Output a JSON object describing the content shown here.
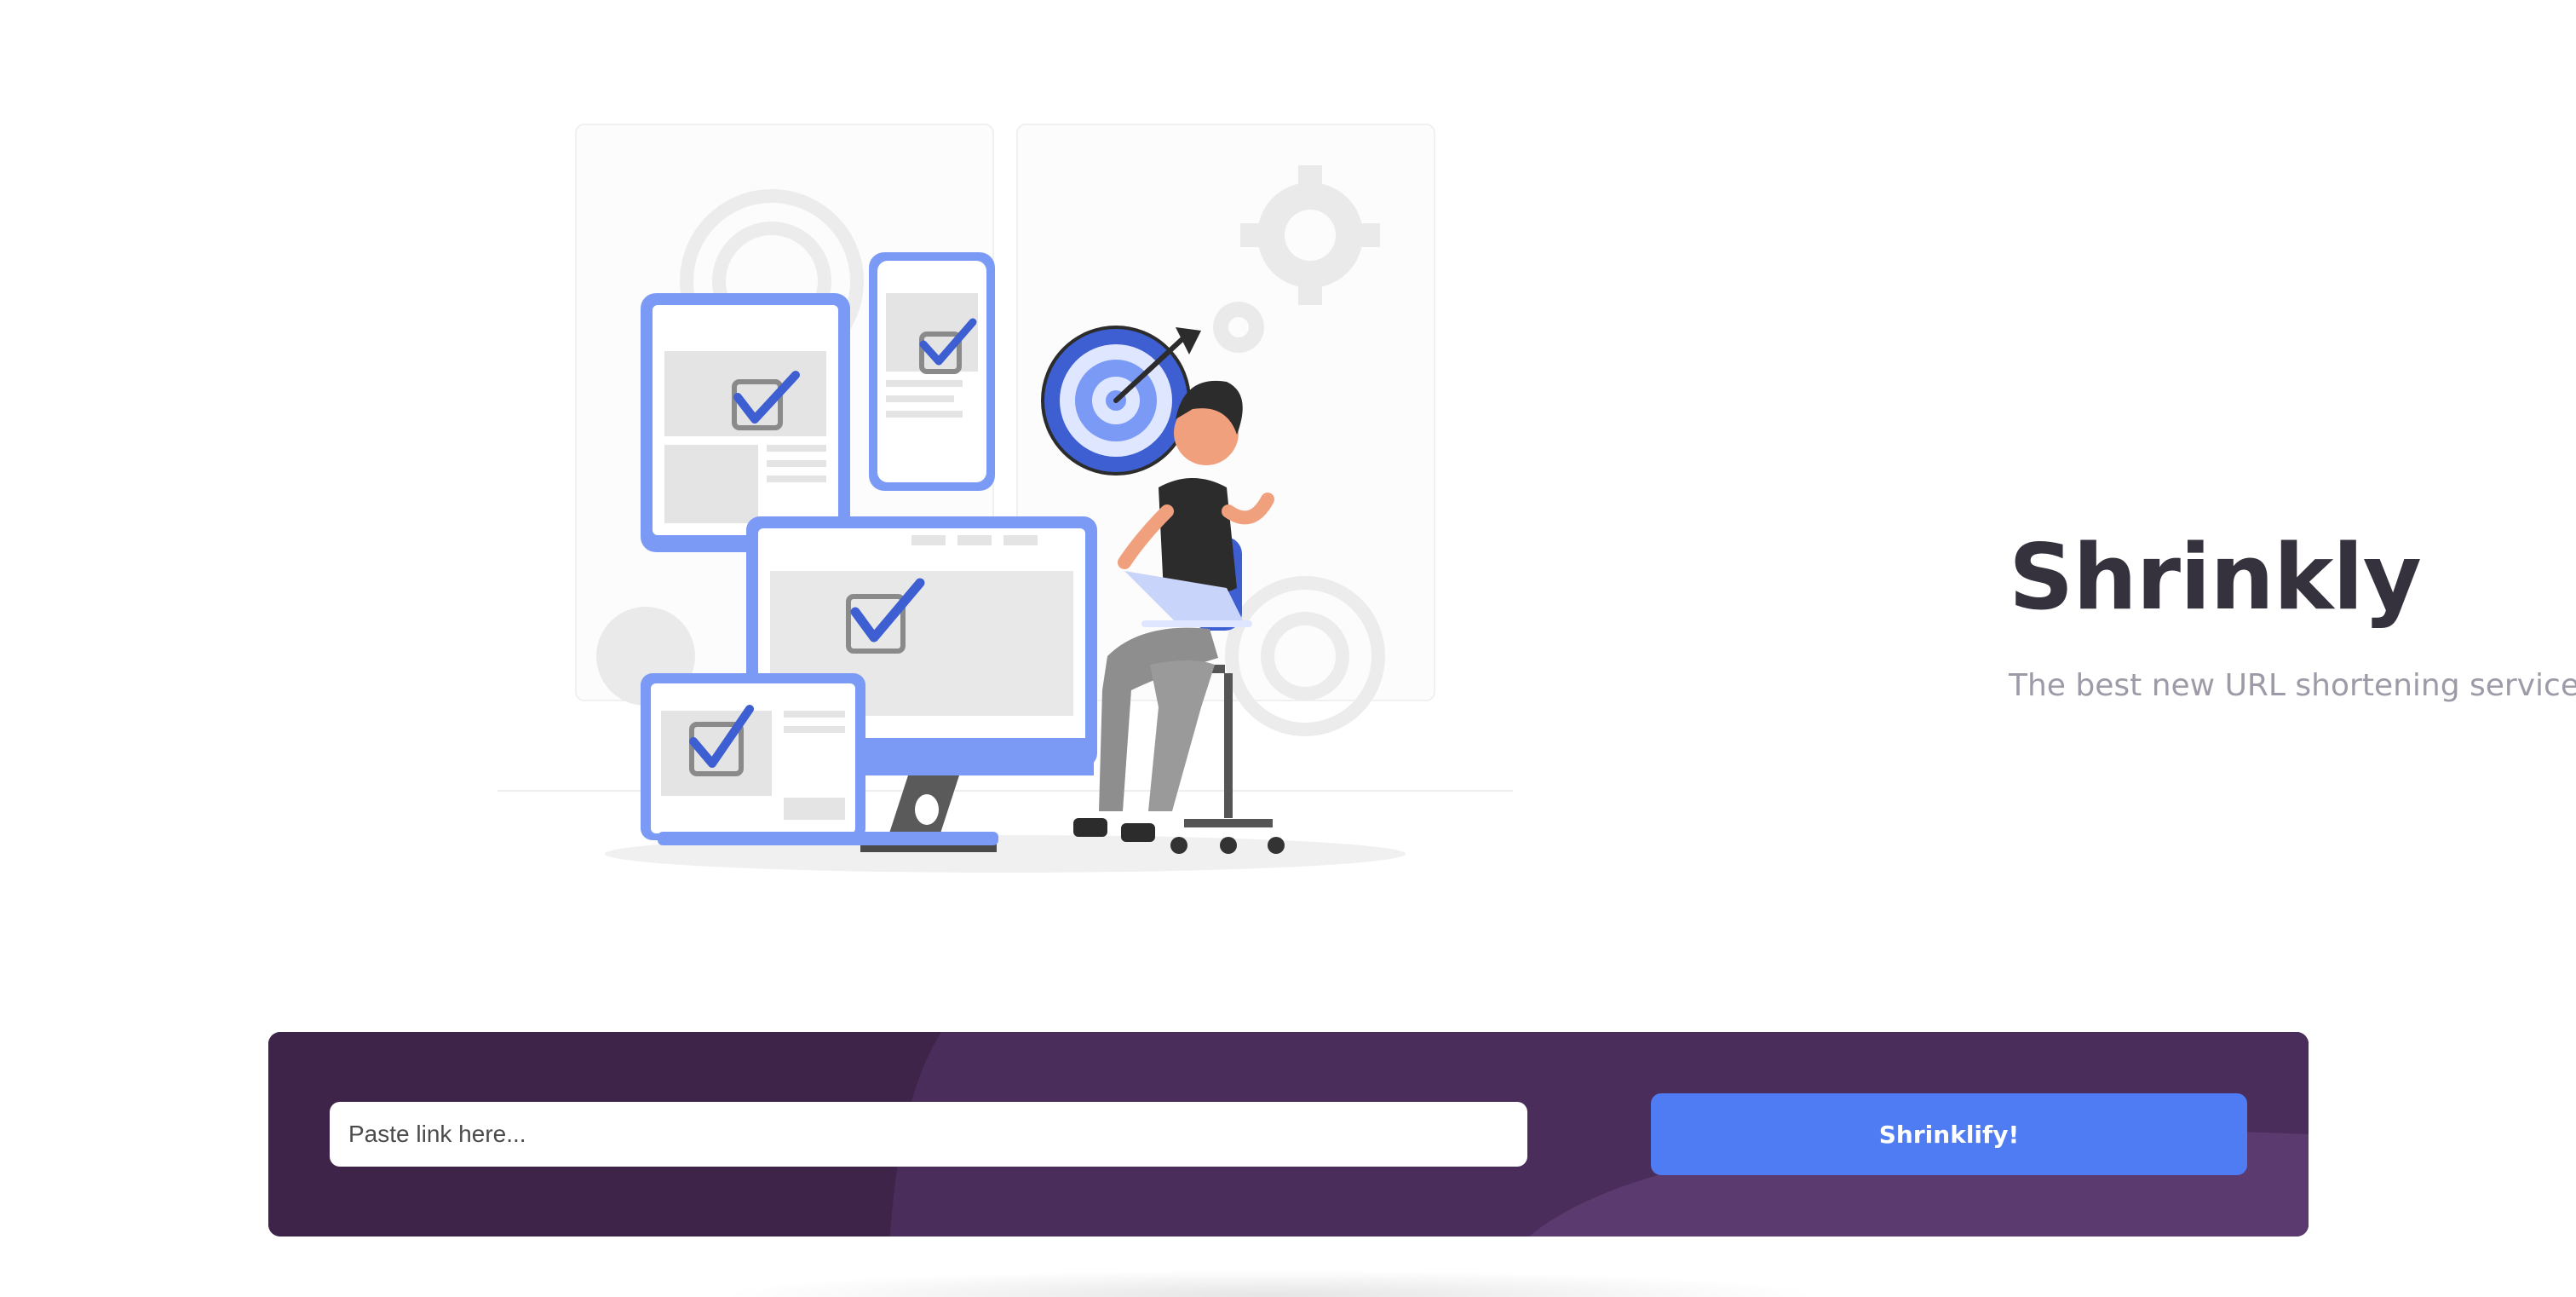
{
  "hero": {
    "title": "Shrinkly",
    "subtitle": "The best new URL shortening service."
  },
  "shorten": {
    "input_placeholder": "Paste link here...",
    "input_value": "",
    "button_label": "Shrinklify!"
  },
  "colors": {
    "accent": "#4f7cf2",
    "panel": "#3b2349",
    "title": "#35323e",
    "subtitle": "#9e9aa7"
  }
}
